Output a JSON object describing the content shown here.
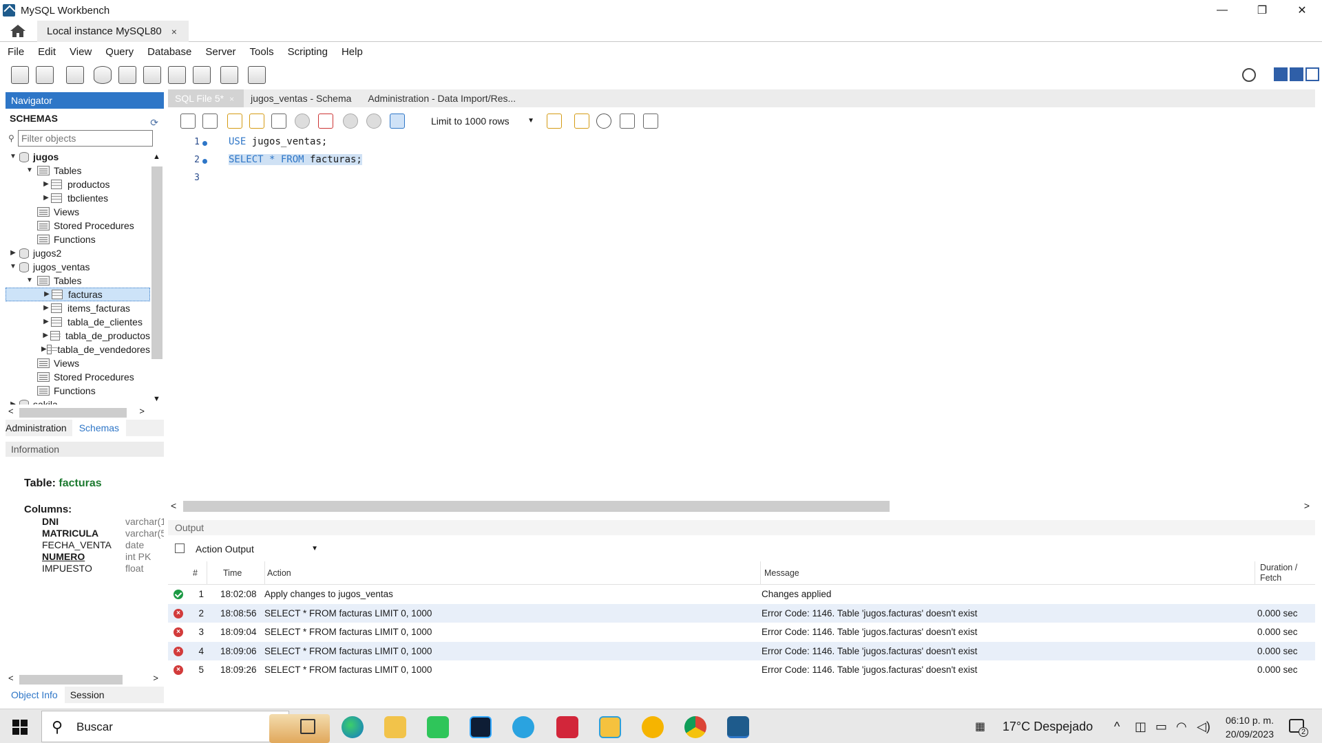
{
  "window": {
    "title": "MySQL Workbench",
    "controls": [
      "—",
      "❐",
      "✕"
    ]
  },
  "connection_tab": {
    "label": "Local instance MySQL80",
    "close": "×"
  },
  "menu": [
    "File",
    "Edit",
    "View",
    "Query",
    "Database",
    "Server",
    "Tools",
    "Scripting",
    "Help"
  ],
  "navigator": {
    "header": "Navigator",
    "schemas_label": "SCHEMAS",
    "filter_placeholder": "Filter objects",
    "tree": [
      {
        "label": "jugos",
        "level": 0,
        "kind": "db",
        "toggle": "▼",
        "bold": true
      },
      {
        "label": "Tables",
        "level": 1,
        "kind": "folder",
        "toggle": "▼"
      },
      {
        "label": "productos",
        "level": 2,
        "kind": "table",
        "toggle": "▶"
      },
      {
        "label": "tbclientes",
        "level": 2,
        "kind": "table",
        "toggle": "▶"
      },
      {
        "label": "Views",
        "level": 1,
        "kind": "folder",
        "toggle": ""
      },
      {
        "label": "Stored Procedures",
        "level": 1,
        "kind": "folder",
        "toggle": ""
      },
      {
        "label": "Functions",
        "level": 1,
        "kind": "folder",
        "toggle": ""
      },
      {
        "label": "jugos2",
        "level": 0,
        "kind": "db",
        "toggle": "▶"
      },
      {
        "label": "jugos_ventas",
        "level": 0,
        "kind": "db",
        "toggle": "▼"
      },
      {
        "label": "Tables",
        "level": 1,
        "kind": "folder",
        "toggle": "▼"
      },
      {
        "label": "facturas",
        "level": 2,
        "kind": "table",
        "toggle": "▶",
        "selected": true
      },
      {
        "label": "items_facturas",
        "level": 2,
        "kind": "table",
        "toggle": "▶"
      },
      {
        "label": "tabla_de_clientes",
        "level": 2,
        "kind": "table",
        "toggle": "▶"
      },
      {
        "label": "tabla_de_productos",
        "level": 2,
        "kind": "table",
        "toggle": "▶"
      },
      {
        "label": "tabla_de_vendedores",
        "level": 2,
        "kind": "table",
        "toggle": "▶"
      },
      {
        "label": "Views",
        "level": 1,
        "kind": "folder",
        "toggle": ""
      },
      {
        "label": "Stored Procedures",
        "level": 1,
        "kind": "folder",
        "toggle": ""
      },
      {
        "label": "Functions",
        "level": 1,
        "kind": "folder",
        "toggle": ""
      },
      {
        "label": "sakila",
        "level": 0,
        "kind": "db",
        "toggle": "▶"
      }
    ],
    "tabs": [
      "Administration",
      "Schemas"
    ],
    "active_tab": "Schemas"
  },
  "information": {
    "header": "Information",
    "table_prefix": "Table:",
    "table_name": "facturas",
    "columns_label": "Columns:",
    "columns": [
      {
        "name": "DNI",
        "type": "varchar(1",
        "bold": true,
        "underline": false
      },
      {
        "name": "MATRICULA",
        "type": "varchar(5",
        "bold": true,
        "underline": false
      },
      {
        "name": "FECHA_VENTA",
        "type": "date",
        "bold": false,
        "underline": false
      },
      {
        "name": "NUMERO",
        "type": "int PK",
        "bold": true,
        "underline": true
      },
      {
        "name": "IMPUESTO",
        "type": "float",
        "bold": false,
        "underline": false
      }
    ],
    "tabs": [
      "Object Info",
      "Session"
    ],
    "active_tab": "Object Info"
  },
  "editor": {
    "tabs": [
      {
        "label": "SQL File 5*",
        "active": true
      },
      {
        "label": "jugos_ventas - Schema",
        "active": false
      },
      {
        "label": "Administration - Data Import/Res...",
        "active": false
      }
    ],
    "limit_label": "Limit to 1000 rows",
    "lines": [
      {
        "num": "1",
        "kw": "USE",
        "rest": " jugos_ventas;",
        "dot": true,
        "selected": false
      },
      {
        "num": "2",
        "kw": "SELECT * FROM",
        "rest": " facturas;",
        "dot": true,
        "selected": true
      },
      {
        "num": "3",
        "kw": "",
        "rest": "",
        "dot": false,
        "selected": false
      }
    ]
  },
  "output": {
    "header": "Output",
    "selector": "Action Output",
    "columns": [
      "#",
      "Time",
      "Action",
      "Message",
      "Duration / Fetch"
    ],
    "rows": [
      {
        "status": "ok",
        "num": "1",
        "time": "18:02:08",
        "action": "Apply changes to jugos_ventas",
        "message": "Changes applied",
        "duration": ""
      },
      {
        "status": "error",
        "num": "2",
        "time": "18:08:56",
        "action": "SELECT * FROM facturas LIMIT 0, 1000",
        "message": "Error Code: 1146. Table 'jugos.facturas' doesn't exist",
        "duration": "0.000 sec"
      },
      {
        "status": "error",
        "num": "3",
        "time": "18:09:04",
        "action": "SELECT * FROM facturas LIMIT 0, 1000",
        "message": "Error Code: 1146. Table 'jugos.facturas' doesn't exist",
        "duration": "0.000 sec"
      },
      {
        "status": "error",
        "num": "4",
        "time": "18:09:06",
        "action": "SELECT * FROM facturas LIMIT 0, 1000",
        "message": "Error Code: 1146. Table 'jugos.facturas' doesn't exist",
        "duration": "0.000 sec"
      },
      {
        "status": "error",
        "num": "5",
        "time": "18:09:26",
        "action": "SELECT * FROM facturas LIMIT 0, 1000",
        "message": "Error Code: 1146. Table 'jugos.facturas' doesn't exist",
        "duration": "0.000 sec"
      }
    ]
  },
  "taskbar": {
    "search_placeholder": "Buscar",
    "weather": "17°C  Despejado",
    "time": "06:10 p. m.",
    "date": "20/09/2023",
    "notifications": "2",
    "apps": [
      "task-view",
      "edge",
      "file-explorer",
      "mobile",
      "photoshop",
      "telegram",
      "media-app",
      "paint-app",
      "clock-app",
      "chrome",
      "mysql-workbench"
    ]
  },
  "colors": {
    "accent": "#2e76c7",
    "ok": "#1c9a44",
    "error": "#d23b3b",
    "table_name": "#1d7a30"
  }
}
